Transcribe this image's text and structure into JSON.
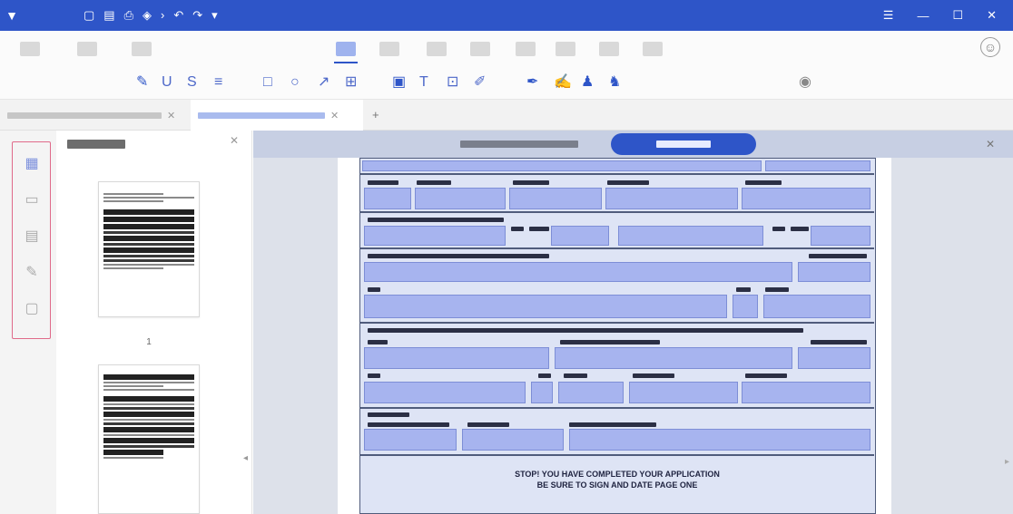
{
  "titlebar": {
    "logo_icon": "app-logo-icon",
    "quick_icons": [
      "new-file-icon",
      "save-icon",
      "print-icon",
      "lock-icon",
      "chevron-icon",
      "undo-icon",
      "redo-icon",
      "pin-icon"
    ],
    "window_icons": [
      "account-icon",
      "minimize-icon",
      "maximize-icon",
      "close-icon"
    ]
  },
  "menubar": {
    "active_tab_index": 3
  },
  "toolbar": {
    "icons": [
      "highlight-icon",
      "underline-icon",
      "strikethrough-icon",
      "wave-underline-icon",
      "rectangle-icon",
      "ellipse-icon",
      "arrow-icon",
      "table-icon",
      "text-box-icon",
      "text-icon",
      "callout-icon",
      "pencil-icon",
      "pen-icon",
      "marker-icon",
      "stamp-icon",
      "signature-icon",
      "eye-icon"
    ]
  },
  "tabs": {
    "add_label": "+"
  },
  "thumbnails": {
    "page_number": "1"
  },
  "viewer": {
    "notice": [
      "STOP! YOU HAVE COMPLETED YOUR APPLICATION",
      "BE SURE TO SIGN AND DATE PAGE ONE"
    ]
  },
  "colors": {
    "accent": "#2e55c8",
    "form_field": "#a7b4ef",
    "highlight_border": "#e06a8a"
  }
}
